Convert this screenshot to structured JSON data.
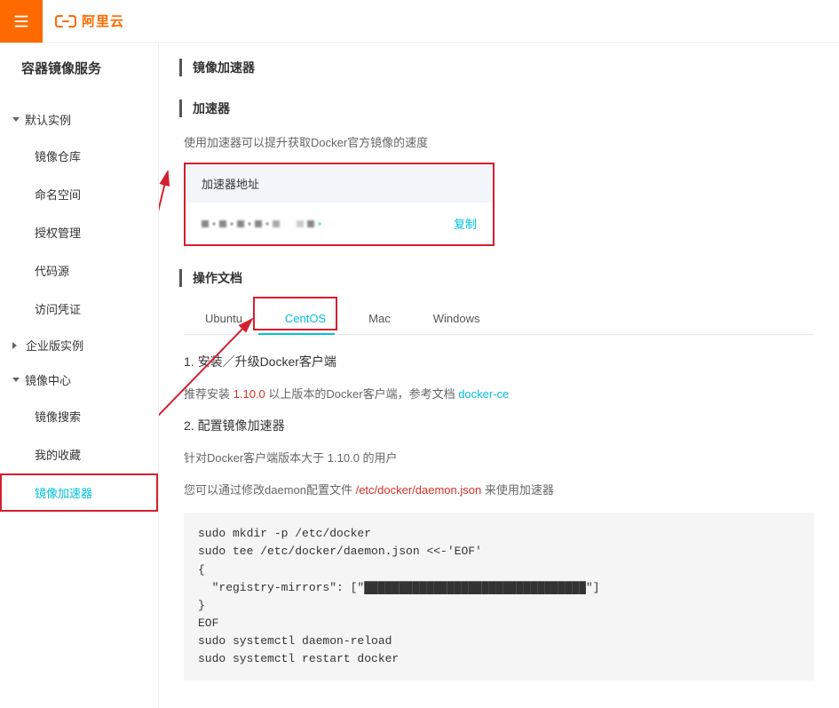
{
  "topbar": {
    "brand": "阿里云"
  },
  "sidebar": {
    "service_title": "容器镜像服务",
    "groups": [
      {
        "label": "默认实例",
        "expanded": true,
        "items": [
          {
            "label": "镜像仓库"
          },
          {
            "label": "命名空间"
          },
          {
            "label": "授权管理"
          },
          {
            "label": "代码源"
          },
          {
            "label": "访问凭证"
          }
        ]
      },
      {
        "label": "企业版实例",
        "expanded": false
      },
      {
        "label": "镜像中心",
        "expanded": true,
        "items": [
          {
            "label": "镜像搜索"
          },
          {
            "label": "我的收藏"
          },
          {
            "label": "镜像加速器",
            "active": true,
            "boxed": true
          }
        ]
      }
    ]
  },
  "page": {
    "title": "镜像加速器",
    "accelerator": {
      "section_title": "加速器",
      "description": "使用加速器可以提升获取Docker官方镜像的速度",
      "addr_header": "加速器地址",
      "copy_label": "复制"
    },
    "docs": {
      "section_title": "操作文档",
      "tabs": [
        {
          "label": "Ubuntu"
        },
        {
          "label": "CentOS",
          "active": true,
          "boxed": true
        },
        {
          "label": "Mac"
        },
        {
          "label": "Windows"
        }
      ],
      "step1_title": "1. 安装／升级Docker客户端",
      "step1_text_pre": "推荐安装 ",
      "step1_version": "1.10.0",
      "step1_text_mid": " 以上版本的Docker客户端，参考文档 ",
      "step1_link": "docker-ce",
      "step2_title": "2. 配置镜像加速器",
      "step2_line1": "针对Docker客户端版本大于 1.10.0 的用户",
      "step2_line2_pre": "您可以通过修改daemon配置文件 ",
      "step2_config_path": "/etc/docker/daemon.json",
      "step2_line2_post": " 来使用加速器",
      "code": "sudo mkdir -p /etc/docker\nsudo tee /etc/docker/daemon.json <<-'EOF'\n{\n  \"registry-mirrors\": [\"████████████████████████████████\"]\n}\nEOF\nsudo systemctl daemon-reload\nsudo systemctl restart docker"
    }
  }
}
